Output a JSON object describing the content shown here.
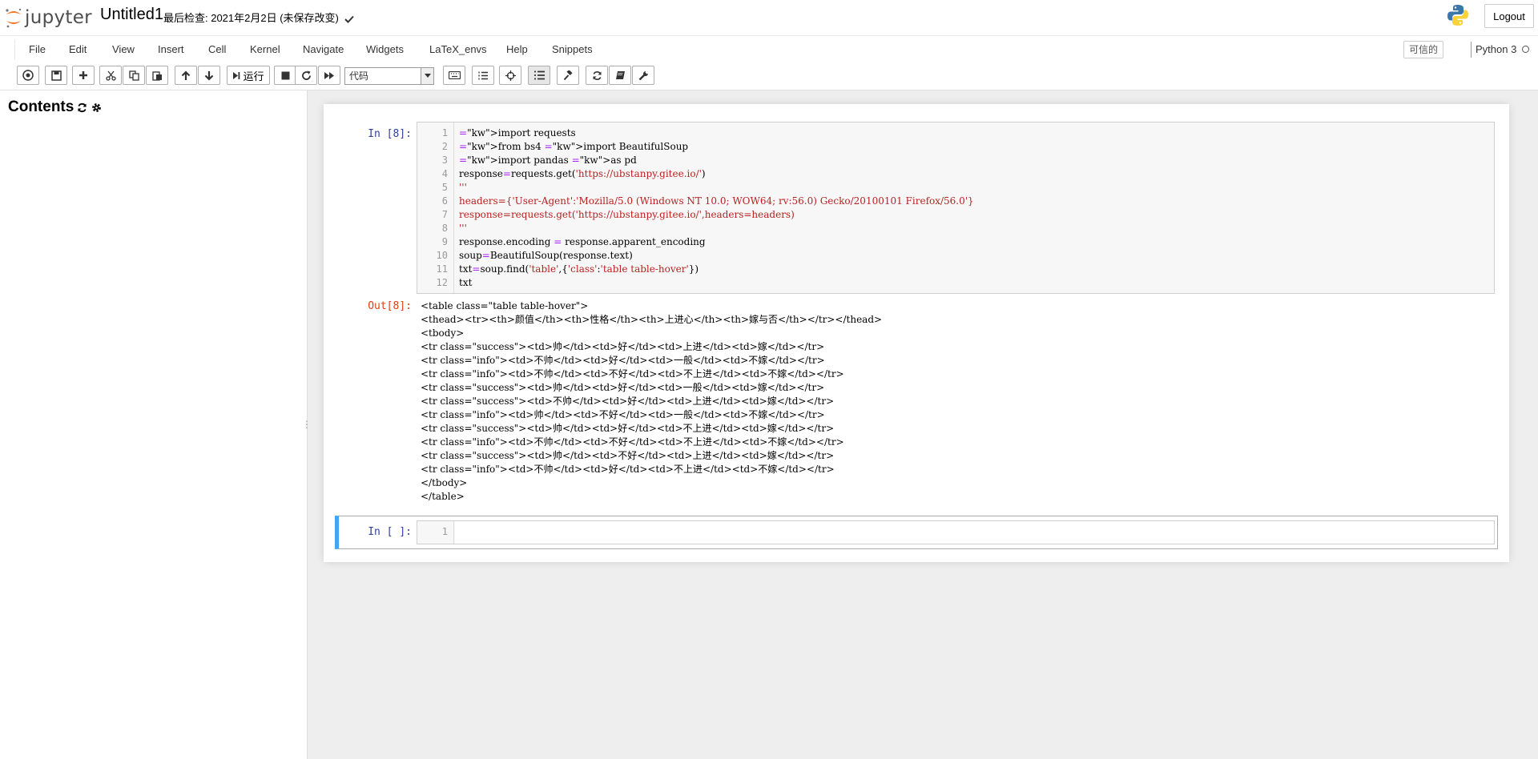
{
  "header": {
    "brand": "jupyter",
    "notebook_name": "Untitled1",
    "checkpoint": "最后检查: 2021年2月2日  (未保存改变)",
    "logout_label": "Logout",
    "brand_colors": {
      "orange": "#f37726",
      "gray": "#767677"
    }
  },
  "menubar": {
    "items": [
      "File",
      "Edit",
      "View",
      "Insert",
      "Cell",
      "Kernel",
      "Navigate",
      "Widgets",
      "LaTeX_envs",
      "Help",
      "Snippets"
    ],
    "trusted_label": "可信的",
    "kernel_name": "Python 3"
  },
  "toolbar": {
    "run_label": "运行",
    "cell_type_value": "代码",
    "icons": [
      "toc-icon",
      "save-icon",
      "plus-icon",
      "cut-icon",
      "copy-icon",
      "paste-icon",
      "arrow-up-icon",
      "arrow-down-icon",
      "step-forward-icon",
      "stop-icon",
      "restart-icon",
      "fast-forward-icon",
      "keyboard-icon",
      "numbered-list-icon",
      "crosshairs-icon",
      "list-icon",
      "gavel-icon",
      "refresh-icon",
      "book-icon",
      "wrench-icon"
    ]
  },
  "toc": {
    "title": "Contents",
    "handle": "⋮"
  },
  "notebook": {
    "cells": [
      {
        "prompt_in": "In  [8]:",
        "prompt_out": "Out[8]:",
        "line_numbers": [
          "1",
          "2",
          "3",
          "4",
          "5",
          "6",
          "7",
          "8",
          "9",
          "10",
          "11",
          "12"
        ],
        "code_lines": [
          "import requests",
          "from bs4 import BeautifulSoup",
          "import pandas as pd",
          "response=requests.get('https://ubstanpy.gitee.io/')",
          "'''",
          "headers={'User-Agent':'Mozilla/5.0 (Windows NT 10.0; WOW64; rv:56.0) Gecko/20100101 Firefox/56.0'}",
          "response=requests.get('https://ubstanpy.gitee.io/',headers=headers)",
          "'''",
          "response.encoding = response.apparent_encoding",
          "soup=BeautifulSoup(response.text)",
          "txt=soup.find('table',{'class':'table table-hover'})",
          "txt"
        ],
        "output_lines": [
          "<table class=\"table table-hover\">",
          "<thead><tr><th>颜值</th><th>性格</th><th>上进心</th><th>嫁与否</th></tr></thead>",
          "<tbody>",
          "<tr class=\"success\"><td>帅</td><td>好</td><td>上进</td><td>嫁</td></tr>",
          "<tr class=\"info\"><td>不帅</td><td>好</td><td>一般</td><td>不嫁</td></tr>",
          "<tr class=\"info\"><td>不帅</td><td>不好</td><td>不上进</td><td>不嫁</td></tr>",
          "<tr class=\"success\"><td>帅</td><td>好</td><td>一般</td><td>嫁</td></tr>",
          "<tr class=\"success\"><td>不帅</td><td>好</td><td>上进</td><td>嫁</td></tr>",
          "<tr class=\"info\"><td>帅</td><td>不好</td><td>一般</td><td>不嫁</td></tr>",
          "<tr class=\"success\"><td>帅</td><td>好</td><td>不上进</td><td>嫁</td></tr>",
          "<tr class=\"info\"><td>不帅</td><td>不好</td><td>不上进</td><td>不嫁</td></tr>",
          "<tr class=\"success\"><td>帅</td><td>不好</td><td>上进</td><td>嫁</td></tr>",
          "<tr class=\"info\"><td>不帅</td><td>好</td><td>不上进</td><td>不嫁</td></tr>",
          "</tbody>",
          "</table>"
        ]
      },
      {
        "prompt_in": "In  [ ]:",
        "line_numbers": [
          "1"
        ]
      }
    ]
  }
}
